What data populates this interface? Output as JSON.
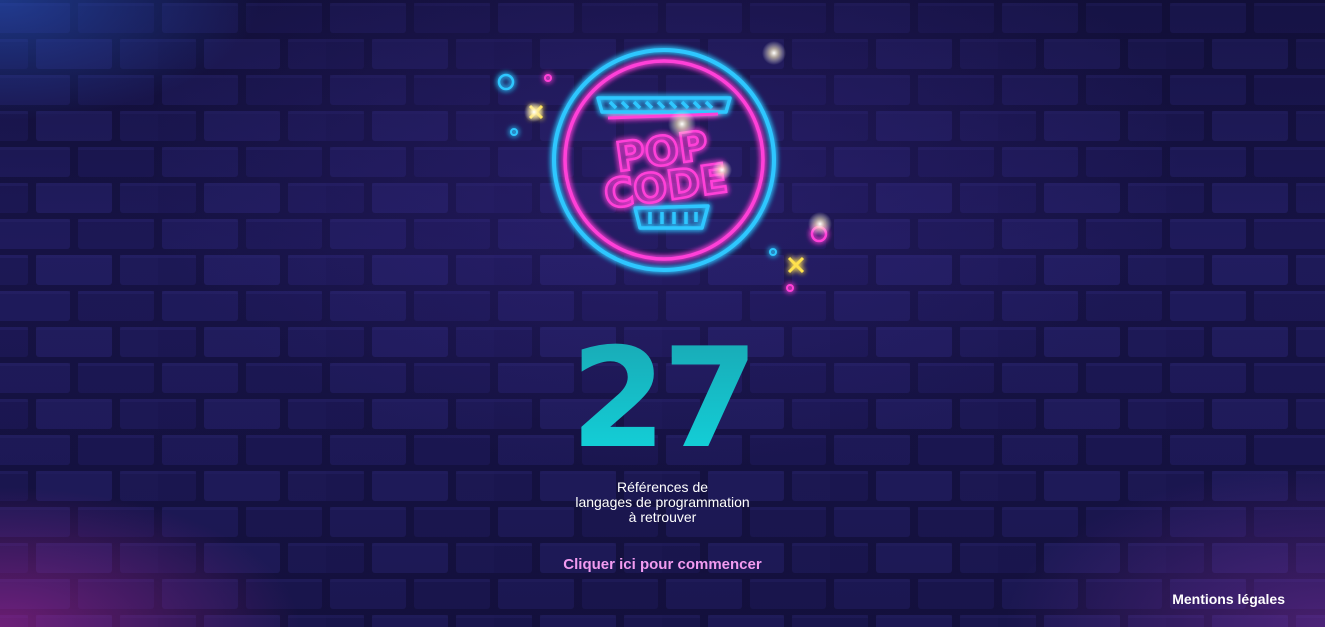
{
  "logo": {
    "line1": "POP",
    "line2": "CODE",
    "icon": "popcorn-neon-icon"
  },
  "counter": {
    "value": "27"
  },
  "subtitle": {
    "line1": "Références de",
    "line2": "langages de programmation",
    "line3": "à retrouver"
  },
  "cta": {
    "label": "Cliquer ici pour commencer"
  },
  "footer": {
    "legal_label": "Mentions légales"
  },
  "colors": {
    "background": "#1a1650",
    "brick": "#221d63",
    "accent_cyan": "#14c6cf",
    "neon_pink": "#ff3fd8",
    "neon_blue": "#2fc7ff",
    "cta_pink": "#f29bf0",
    "text": "#ffffff"
  }
}
